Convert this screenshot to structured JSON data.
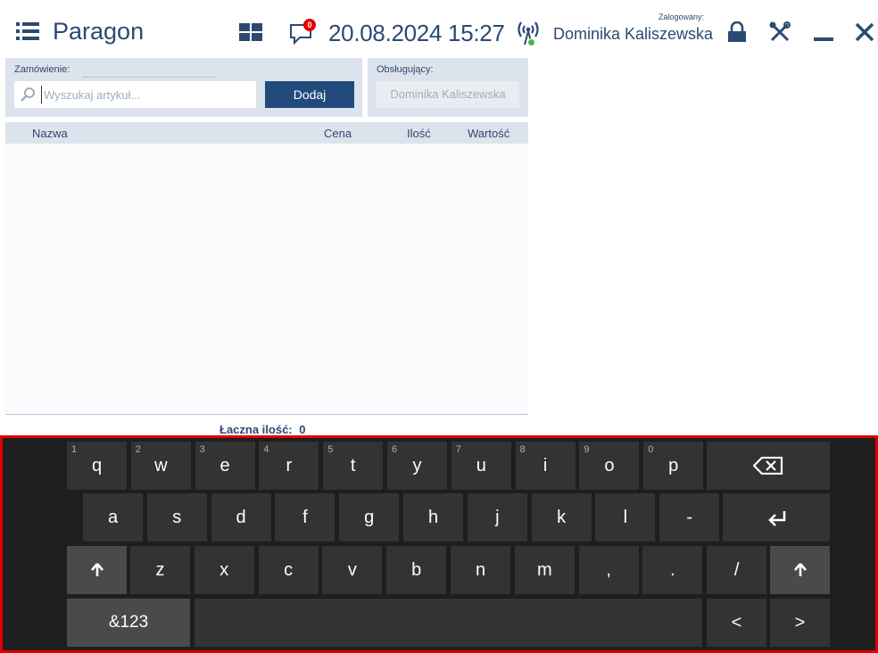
{
  "header": {
    "app_title": "Paragon",
    "notification_count": "0",
    "datetime": "20.08.2024 15:27",
    "logged_label": "Zalogowany:",
    "logged_user": "Dominika Kaliszewska"
  },
  "order": {
    "label": "Zamówienie:",
    "search_placeholder": "Wyszukaj artykuł...",
    "add_label": "Dodaj"
  },
  "served": {
    "label": "Obsługujący:",
    "value": "Dominika Kaliszewska"
  },
  "table": {
    "columns": {
      "name": "Nazwa",
      "price": "Cena",
      "qty": "Ilość",
      "value": "Wartość"
    }
  },
  "summary": {
    "total_label": "Łaczna ilość:",
    "total_value": "0"
  },
  "keyboard": {
    "row1": [
      {
        "label": "q",
        "hint": "1"
      },
      {
        "label": "w",
        "hint": "2"
      },
      {
        "label": "e",
        "hint": "3"
      },
      {
        "label": "r",
        "hint": "4"
      },
      {
        "label": "t",
        "hint": "5"
      },
      {
        "label": "y",
        "hint": "6"
      },
      {
        "label": "u",
        "hint": "7"
      },
      {
        "label": "i",
        "hint": "8"
      },
      {
        "label": "o",
        "hint": "9"
      },
      {
        "label": "p",
        "hint": "0"
      }
    ],
    "row2": [
      "a",
      "s",
      "d",
      "f",
      "g",
      "h",
      "j",
      "k",
      "l",
      "-"
    ],
    "row3": [
      "z",
      "x",
      "c",
      "v",
      "b",
      "n",
      "m",
      ",",
      ".",
      "/"
    ],
    "symbols_label": "&123",
    "left_label": "<",
    "right_label": ">"
  }
}
